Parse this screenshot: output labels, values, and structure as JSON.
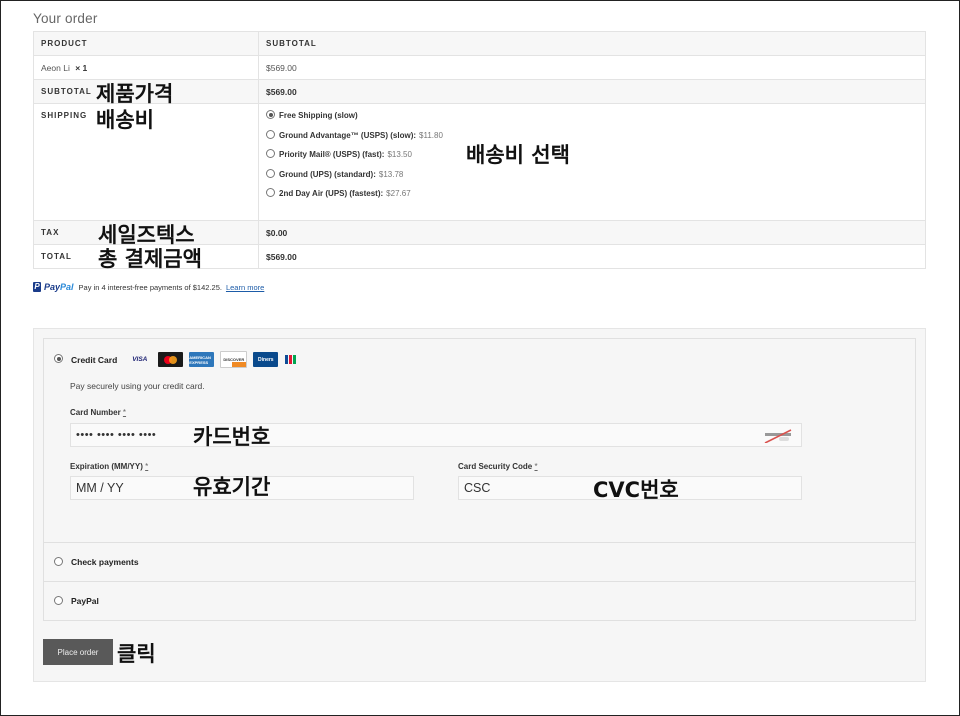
{
  "page": {
    "title": "Your order"
  },
  "order_table": {
    "headers": {
      "product": "PRODUCT",
      "subtotal": "SUBTOTAL"
    },
    "item": {
      "name": "Aeon Li",
      "qty": "× 1",
      "price": "$569.00"
    },
    "subtotal": {
      "label": "SUBTOTAL",
      "value": "$569.00"
    },
    "shipping": {
      "label": "SHIPPING",
      "options": [
        {
          "name": "Free Shipping (slow)",
          "price": "",
          "selected": true
        },
        {
          "name": "Ground Advantage™ (USPS) (slow):",
          "price": "$11.80",
          "selected": false
        },
        {
          "name": "Priority Mail® (USPS) (fast):",
          "price": "$13.50",
          "selected": false
        },
        {
          "name": "Ground (UPS) (standard):",
          "price": "$13.78",
          "selected": false
        },
        {
          "name": "2nd Day Air (UPS) (fastest):",
          "price": "$27.67",
          "selected": false
        }
      ]
    },
    "tax": {
      "label": "TAX",
      "value": "$0.00"
    },
    "total": {
      "label": "TOTAL",
      "value": "$569.00"
    }
  },
  "annotations": {
    "subtotal": "제품가격",
    "shipping": "배송비",
    "shipping_select": "배송비 선택",
    "tax": "세일즈텍스",
    "total": "총 결제금액",
    "card_number": "카드번호",
    "expiration": "유효기간",
    "cvc": "CVC번호",
    "place_order": "클릭"
  },
  "paypal_banner": {
    "logo_pay": "Pay",
    "logo_pal": "Pal",
    "text": "Pay in 4 interest-free payments of $142.25.",
    "link": "Learn more"
  },
  "payment": {
    "methods": [
      {
        "label": "Credit Card",
        "selected": true
      },
      {
        "label": "Check payments",
        "selected": false
      },
      {
        "label": "PayPal",
        "selected": false
      }
    ],
    "card_brands": [
      "visa-logo",
      "mastercard-logo",
      "amex-logo",
      "discover-logo",
      "diners-logo",
      "jcb-logo"
    ],
    "card_brand_text": {
      "visa": "VISA",
      "amex": "AMERICAN EXPRESS",
      "discover": "DISCOVER",
      "diners": "Diners"
    },
    "description": "Pay securely using your credit card.",
    "card_number": {
      "label": "Card Number",
      "required": "*",
      "value": "•••• •••• •••• ••••"
    },
    "expiration": {
      "label": "Expiration (MM/YY)",
      "required": "*",
      "placeholder": "MM / YY"
    },
    "csc": {
      "label": "Card Security Code",
      "required": "*",
      "placeholder": "CSC"
    },
    "place_order": "Place order"
  },
  "colors": {
    "button_bg": "#595959",
    "paypal_dark": "#1a3b8a",
    "paypal_light": "#2b8ad8",
    "link": "#1d5ca8"
  }
}
